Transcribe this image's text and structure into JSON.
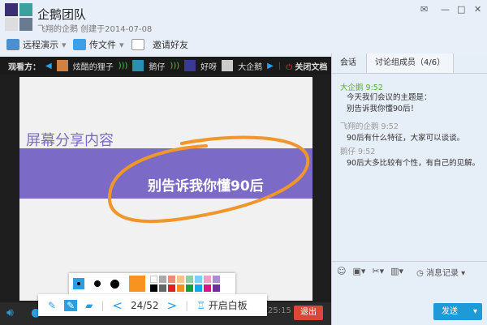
{
  "window": {
    "title": "企鹅团队",
    "subtitle": "飞翔的企鹅 创建于2014-07-08"
  },
  "toolbar": {
    "remote": "远程演示",
    "file": "传文件",
    "invite": "邀请好友"
  },
  "viewers": {
    "label": "观看方：",
    "names": [
      "炫酷的狸子",
      "鹅仔",
      "好呀",
      "大企鹅"
    ],
    "close_doc": "关闭文档"
  },
  "slide": {
    "heading": "屏幕分享内容",
    "banner": "别告诉我你懂90后"
  },
  "whiteboard": {
    "page": "24/52",
    "open_label": "开启白板",
    "colors": [
      "#ffffff",
      "#aaaaaa",
      "#f08a76",
      "#f8c48e",
      "#8fd0a0",
      "#7fd0f6",
      "#f29ec8",
      "#a98fcf",
      "#000000",
      "#666666",
      "#e02020",
      "#f39020",
      "#10a040",
      "#10a8e8",
      "#e0108a",
      "#6a30a0"
    ],
    "current_color": "#f7931e"
  },
  "status": {
    "timer": "25:15",
    "exit": "退出"
  },
  "chat": {
    "tabs": [
      "会话",
      "讨论组成员（4/6）"
    ],
    "messages": [
      {
        "sender": "大企鹅",
        "time": "9:52",
        "lines": [
          "今天我们会议的主题是：",
          "别告诉我你懂90后！"
        ]
      },
      {
        "sender": "飞翔的企鹅",
        "time": "9:52",
        "lines": [
          "90后有什么特征，大家可以谈谈。"
        ]
      },
      {
        "sender": "鹅仔",
        "time": "9:52",
        "lines": [
          "90后大多比较有个性，有自己的见解。"
        ]
      }
    ],
    "history": "消息记录",
    "send": "发送"
  }
}
